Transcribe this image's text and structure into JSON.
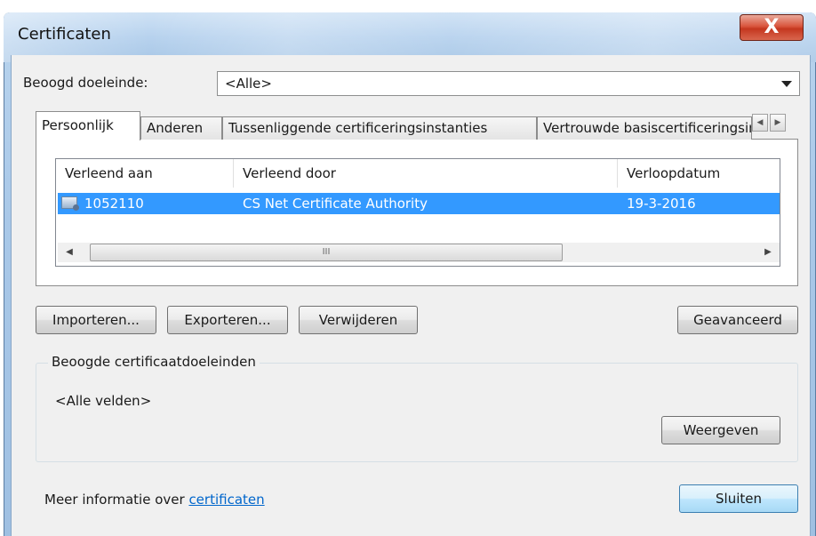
{
  "window": {
    "title": "Certificaten",
    "close_glyph": "X"
  },
  "purpose": {
    "label": "Beoogd doeleinde:",
    "selected": "<Alle>"
  },
  "tabs": [
    {
      "label": "Persoonlijk",
      "active": true
    },
    {
      "label": "Anderen",
      "active": false
    },
    {
      "label": "Tussenliggende certificeringsinstanties",
      "active": false
    },
    {
      "label": "Vertrouwde basiscertificeringsinstanties",
      "active": false
    }
  ],
  "tab_scroll": {
    "left": "◀",
    "right": "▶"
  },
  "list": {
    "columns": [
      "Verleend aan",
      "Verleend door",
      "Verloopdatum"
    ],
    "rows": [
      {
        "issued_to": "1052110",
        "issued_by": "CS Net Certificate Authority",
        "expires": "19-3-2016",
        "selected": true
      }
    ],
    "scroll_thumb_glyph": "III",
    "scroll_left": "◀",
    "scroll_right": "▶"
  },
  "buttons": {
    "import": "Importeren...",
    "export": "Exporteren...",
    "remove": "Verwijderen",
    "advanced": "Geavanceerd",
    "view": "Weergeven",
    "close": "Sluiten"
  },
  "purposes_group": {
    "title": "Beoogde certificaatdoeleinden",
    "value": "<Alle velden>"
  },
  "footer": {
    "text": "Meer informatie over ",
    "link": "certificaten"
  },
  "colors": {
    "selection": "#3399ff",
    "close_button": "#c4371f",
    "link": "#0066cc"
  },
  "icons": [
    "close-icon",
    "dropdown-arrow-icon",
    "certificate-icon",
    "scroll-left-icon",
    "scroll-right-icon"
  ]
}
